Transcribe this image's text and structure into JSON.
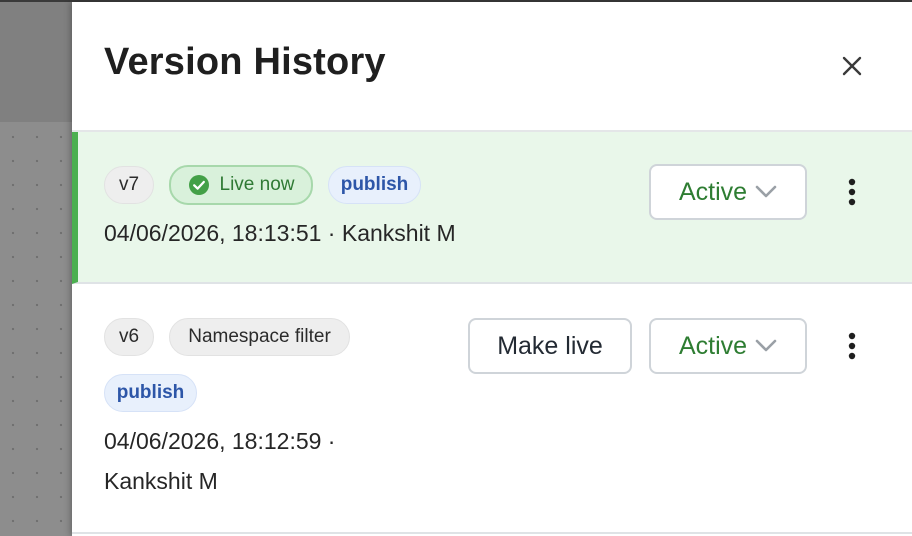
{
  "drawer": {
    "title": "Version History",
    "close_icon": "close-icon"
  },
  "versions": [
    {
      "version": "v7",
      "badges": [
        {
          "label": "Live now",
          "icon": "check-circle-icon"
        },
        {
          "label": "publish"
        }
      ],
      "timestamp": "04/06/2026, 18:13:51 · Kankshit M",
      "status": "Active",
      "is_live": true
    },
    {
      "version": "v6",
      "badges": [
        {
          "label": "Namespace filter"
        },
        {
          "label": "publish"
        }
      ],
      "timestamp_line1": "04/06/2026, 18:12:59 ·",
      "timestamp_line2": "Kankshit M",
      "make_live_label": "Make live",
      "status": "Active",
      "is_live": false
    }
  ],
  "colors": {
    "accent_green": "#4caf50",
    "live_row_bg": "#e9f7ea",
    "status_text": "#2e7d32",
    "publish_text": "#2d56a8"
  }
}
